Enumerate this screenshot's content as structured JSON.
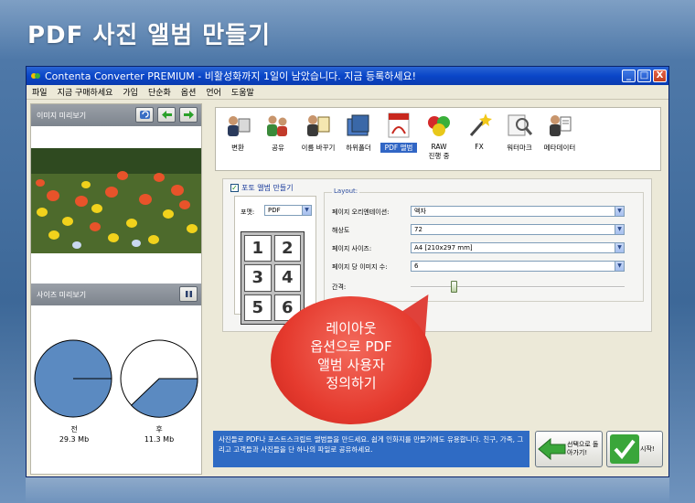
{
  "banner": {
    "title": "PDF 사진 앨범 만들기"
  },
  "window": {
    "title": "Contenta Converter PREMIUM - 비활성화까지 1일이 남았습니다. 지금 등록하세요!",
    "buttons": {
      "minimize": "_",
      "maximize": "□",
      "close": "X"
    }
  },
  "menu": [
    "파일",
    "지금 구매하세요",
    "가입",
    "단순화",
    "옵션",
    "언어",
    "도움말"
  ],
  "left_panel": {
    "preview_title": "이미지 미리보기",
    "size_preview_title": "사이즈 미리보기",
    "before_label": "전",
    "before_size": "29.3 Mb",
    "after_label": "후",
    "after_size": "11.3 Mb"
  },
  "tools": [
    {
      "label": "변환",
      "icon": "people-convert-icon"
    },
    {
      "label": "공유",
      "icon": "people-share-icon"
    },
    {
      "label": "이름 바꾸기",
      "icon": "rename-icon"
    },
    {
      "label": "하위폴더",
      "icon": "folder-icon"
    },
    {
      "label": "PDF 앨범",
      "icon": "pdf-icon"
    },
    {
      "label": "RAW\n진행 중",
      "icon": "raw-icon"
    },
    {
      "label": "FX",
      "icon": "wand-icon"
    },
    {
      "label": "워터마크",
      "icon": "magnifier-icon"
    },
    {
      "label": "메타데이터",
      "icon": "metadata-icon"
    }
  ],
  "photo_album": {
    "section_title": "포토 앨범 만들기",
    "format_label": "포맷:",
    "format_value": "PDF",
    "grid_numbers": [
      "1",
      "2",
      "3",
      "4",
      "5",
      "6"
    ],
    "layout_legend": "Layout:",
    "orientation_label": "페이지 오리엔테이션:",
    "orientation_value": "액자",
    "resolution_label": "해상도",
    "resolution_value": "72",
    "page_size_label": "페이지 사이즈:",
    "page_size_value": "A4 [210x297 mm]",
    "images_per_page_label": "페이지 당 이미지 수:",
    "images_per_page_value": "6",
    "spacing_label": "간격:",
    "spacing_level": 0.2
  },
  "callout": {
    "line1": "레이아웃",
    "line2": "옵션으로 PDF",
    "line3": "앨범 사용자",
    "line4": "정의하기"
  },
  "bottom_note": {
    "text": "사진들로 PDF나 포스트스크립트 앨범들을 만드세요. 쉽게 인화지를 만들기에도 유용합니다. 친구, 가족, 그리고 고객들과 사진들을 단 하나의 파일로 공유하세요."
  },
  "actions": {
    "back_label": "선택으로 돌아가기!",
    "start_label": "시작!"
  },
  "colors": {
    "pie_fill": "#5b8ac1",
    "callout": "#e53a2e",
    "note_bg": "#2f6bc4"
  }
}
